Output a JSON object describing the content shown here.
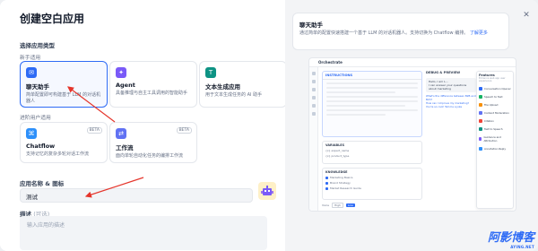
{
  "dialog": {
    "title": "创建空白应用",
    "close_icon": "close-icon"
  },
  "app_type": {
    "label": "选择应用类型",
    "beginner_label": "新手适用",
    "advanced_label": "进阶用户适用",
    "cards": [
      {
        "title": "聊天助手",
        "desc": "简单配置即可构建基于 LLM 的对话机器人",
        "icon": "chat-bubble-icon",
        "color": "#2e6bf5"
      },
      {
        "title": "Agent",
        "desc": "具备推理与自主工具调用的智能助手",
        "icon": "agent-icon",
        "color": "#7a5af8"
      },
      {
        "title": "文本生成应用",
        "desc": "用于文本生成任务的 AI 助手",
        "icon": "text-icon",
        "color": "#0e9384"
      },
      {
        "title": "Chatflow",
        "desc": "支持记忆的复杂多轮对话工作流",
        "icon": "chatflow-icon",
        "color": "#2e90fa",
        "badge": "BETA"
      },
      {
        "title": "工作流",
        "desc": "面向单轮自动化任务的编排工作流",
        "icon": "workflow-icon",
        "color": "#6172f3",
        "badge": "BETA"
      }
    ]
  },
  "name_field": {
    "label": "应用名称 & 图标",
    "value": "测试"
  },
  "desc_field": {
    "label": "描述",
    "optional": "(可选)",
    "placeholder": "输入应用的描述"
  },
  "preview_info": {
    "title": "聊天助手",
    "desc": "通过简单的配置快速搭建一个基于 LLM 的对话机器人。支持切换为 Chatflow 编排。",
    "link": "了解更多"
  },
  "preview": {
    "app_name": "Orchestrate",
    "instructions": "INSTRUCTIONS",
    "debug": "DEBUG & PREVIEW",
    "variables": "VARIABLES",
    "knowledge": "KNOWLEDGE",
    "knowledge_items": [
      "Marketing Basics",
      "Brand Strategy",
      "Market Research Guide"
    ],
    "variable_items": [
      "{x} expert_name",
      "{x} product_type"
    ],
    "chat_greeting": "Hello, I am L...",
    "chat_text": "I can answer your questions about marketing",
    "chat_links": [
      "What's the difference between B2B and B2C?",
      "How can I improve my marketing?",
      "You're so cool! Tell me a joke"
    ],
    "features": "Features",
    "features_desc": "Enhance web app user experience",
    "feature_items": [
      {
        "name": "Conversation Opener",
        "color": "#2e6bf5"
      },
      {
        "name": "Speech to Text",
        "color": "#16b364"
      },
      {
        "name": "File Upload",
        "color": "#f79009"
      },
      {
        "name": "Content Moderation",
        "color": "#6172f3"
      },
      {
        "name": "Citation",
        "color": "#f04438"
      },
      {
        "name": "Text to Speech",
        "color": "#0e9384"
      },
      {
        "name": "Guidance and Attribution",
        "color": "#7a5af8"
      },
      {
        "name": "Annotation Reply",
        "color": "#2e90fa"
      }
    ],
    "bottom": {
      "voice": "Voice",
      "high": "High",
      "low": "Low"
    }
  },
  "watermark": {
    "text": "阿影博客",
    "sub": "AYING.NET"
  }
}
